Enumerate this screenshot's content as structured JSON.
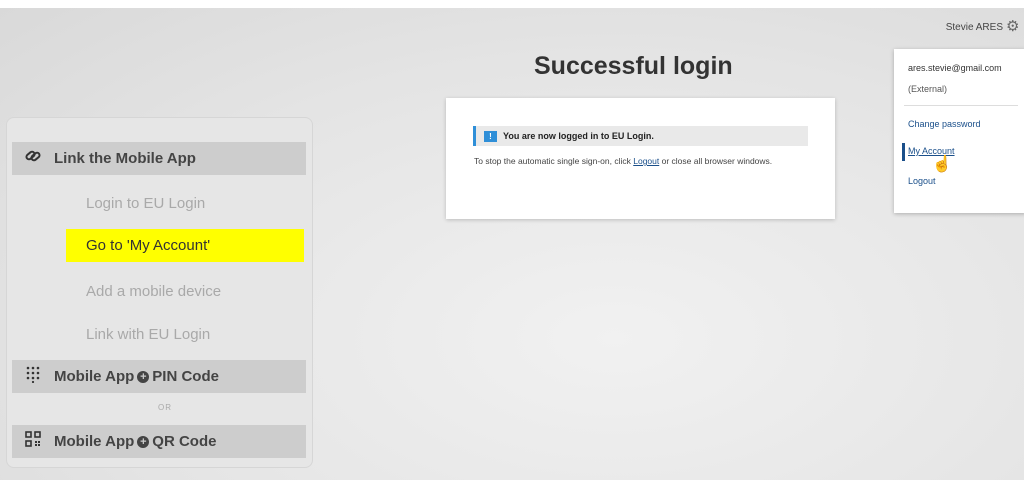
{
  "header": {
    "user_name": "Stevie ARES",
    "gear_icon": "gear-icon"
  },
  "dropdown": {
    "email": "ares.stevie@gmail.com",
    "account_type": "(External)",
    "change_password": "Change password",
    "my_account": "My Account",
    "logout": "Logout"
  },
  "main": {
    "title": "Successful login",
    "info_message": "You are now logged in to EU Login.",
    "sso_text_before": "To stop the automatic single sign-on, click",
    "logout_link": "Logout",
    "sso_text_after": "or close all browser windows."
  },
  "steps": {
    "link_mobile_app": "Link the Mobile App",
    "login_eu": "Login to EU Login",
    "go_my_account": "Go to 'My Account'",
    "add_device": "Add a mobile device",
    "link_eu": "Link with EU Login",
    "pin_prefix": "Mobile App",
    "pin_suffix": "PIN Code",
    "or": "OR",
    "qr_prefix": "Mobile App",
    "qr_suffix": "QR Code"
  },
  "colors": {
    "highlight": "#ffff00",
    "link": "#1a4f8a",
    "info_accent": "#2f8fd8"
  }
}
